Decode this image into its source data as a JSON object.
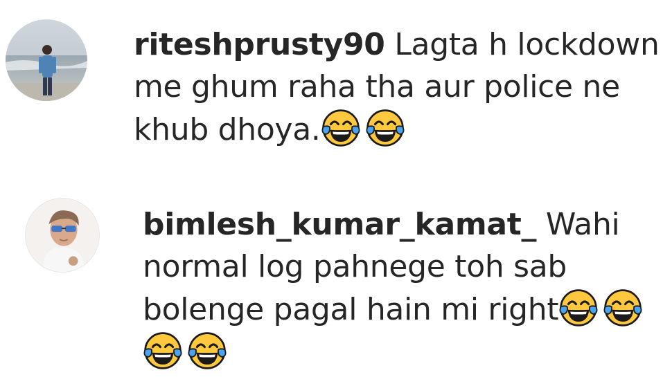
{
  "comments": [
    {
      "username": "riteshprusty90",
      "text": "Lagta h lockdown me ghum raha tha aur police ne khub dhoya.",
      "emojis": [
        "face-with-tears-of-joy-icon",
        "face-with-tears-of-joy-icon"
      ]
    },
    {
      "username": "bimlesh_kumar_kamat_",
      "text": "Wahi normal log pahnege toh sab bolenge pagal hain mi right",
      "emojis": [
        "face-with-tears-of-joy-icon",
        "face-with-tears-of-joy-icon",
        "face-with-tears-of-joy-icon",
        "face-with-tears-of-joy-icon"
      ]
    }
  ],
  "colors": {
    "text": "#262626",
    "emoji_face": "#ffc83d",
    "emoji_tear": "#4aa3ef"
  }
}
